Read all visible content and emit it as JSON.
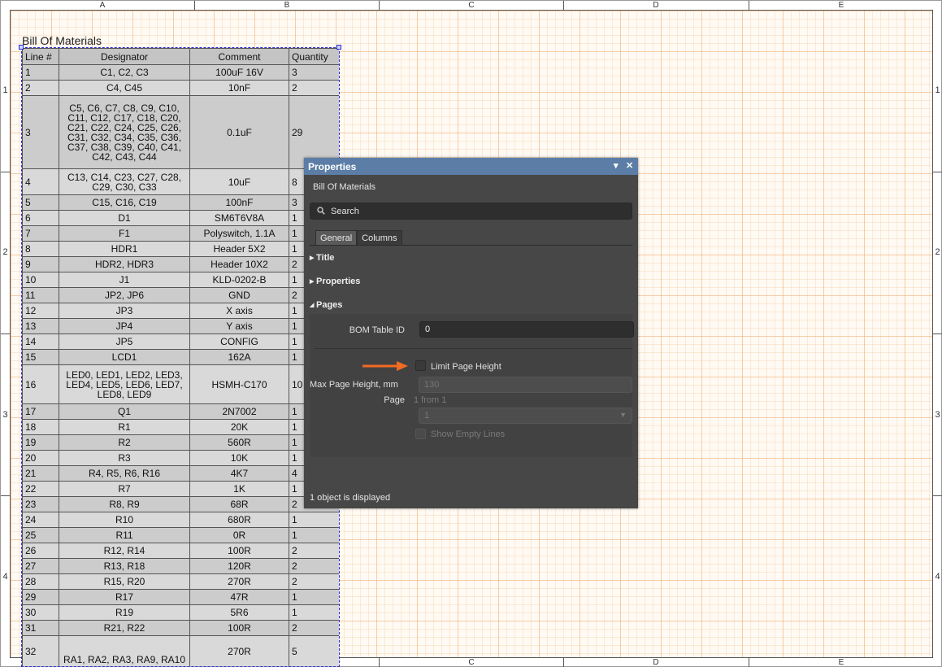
{
  "sheet": {
    "columns": [
      "A",
      "B",
      "C",
      "D",
      "E"
    ],
    "rows": [
      "1",
      "2",
      "3",
      "4"
    ]
  },
  "bom": {
    "title": "Bill Of Materials",
    "headers": [
      "Line #",
      "Designator",
      "Comment",
      "Quantity"
    ],
    "rows": [
      [
        "1",
        "C1, C2, C3",
        "100uF 16V",
        "3"
      ],
      [
        "2",
        "C4, C45",
        "10nF",
        "2"
      ],
      [
        "3",
        "C5, C6, C7, C8, C9, C10, C11, C12, C17, C18, C20, C21, C22, C24, C25, C26, C31, C32, C34, C35, C36, C37, C38, C39, C40, C41, C42, C43, C44",
        "0.1uF",
        "29"
      ],
      [
        "4",
        "C13, C14, C23, C27, C28, C29, C30, C33",
        "10uF",
        "8"
      ],
      [
        "5",
        "C15, C16, C19",
        "100nF",
        "3"
      ],
      [
        "6",
        "D1",
        "SM6T6V8A",
        "1"
      ],
      [
        "7",
        "F1",
        "Polyswitch, 1.1A",
        "1"
      ],
      [
        "8",
        "HDR1",
        "Header 5X2",
        "1"
      ],
      [
        "9",
        "HDR2, HDR3",
        "Header 10X2",
        "2"
      ],
      [
        "10",
        "J1",
        "KLD-0202-B",
        "1"
      ],
      [
        "11",
        "JP2, JP6",
        "GND",
        "2"
      ],
      [
        "12",
        "JP3",
        "X axis",
        "1"
      ],
      [
        "13",
        "JP4",
        "Y axis",
        "1"
      ],
      [
        "14",
        "JP5",
        "CONFIG",
        "1"
      ],
      [
        "15",
        "LCD1",
        "162A",
        "1"
      ],
      [
        "16",
        "LED0, LED1, LED2, LED3, LED4, LED5, LED6, LED7, LED8, LED9",
        "HSMH-C170",
        "10"
      ],
      [
        "17",
        "Q1",
        "2N7002",
        "1"
      ],
      [
        "18",
        "R1",
        "20K",
        "1"
      ],
      [
        "19",
        "R2",
        "560R",
        "1"
      ],
      [
        "20",
        "R3",
        "10K",
        "1"
      ],
      [
        "21",
        "R4, R5, R6, R16",
        "4K7",
        "4"
      ],
      [
        "22",
        "R7",
        "1K",
        "1"
      ],
      [
        "23",
        "R8, R9",
        "68R",
        "2"
      ],
      [
        "24",
        "R10",
        "680R",
        "1"
      ],
      [
        "25",
        "R11",
        "0R",
        "1"
      ],
      [
        "26",
        "R12, R14",
        "100R",
        "2"
      ],
      [
        "27",
        "R13, R18",
        "120R",
        "2"
      ],
      [
        "28",
        "R15, R20",
        "270R",
        "2"
      ],
      [
        "29",
        "R17",
        "47R",
        "1"
      ],
      [
        "30",
        "R19",
        "5R6",
        "1"
      ],
      [
        "31",
        "R21, R22",
        "100R",
        "2"
      ],
      [
        "32",
        "RA1, RA2, RA3, RA9, RA10",
        "270R",
        "5"
      ]
    ]
  },
  "panel": {
    "title": "Properties",
    "subtitle": "Bill Of Materials",
    "search_placeholder": "Search",
    "tabs": [
      "General",
      "Columns"
    ],
    "sections": {
      "title": "Title",
      "properties": "Properties",
      "pages": "Pages"
    },
    "bom_table_id_label": "BOM Table ID",
    "bom_table_id_value": "0",
    "limit_page_height_label": "Limit Page Height",
    "max_page_height_label": "Max Page Height, mm",
    "max_page_height_value": "130",
    "page_label": "Page",
    "page_info": "1 from 1",
    "page_select_value": "1",
    "show_empty_lines_label": "Show Empty Lines",
    "status": "1 object is displayed"
  },
  "colors": {
    "panel_header": "#5b7da6",
    "panel_bg": "#474747",
    "arrow": "#f26b21",
    "selection": "#2b2bd4"
  }
}
